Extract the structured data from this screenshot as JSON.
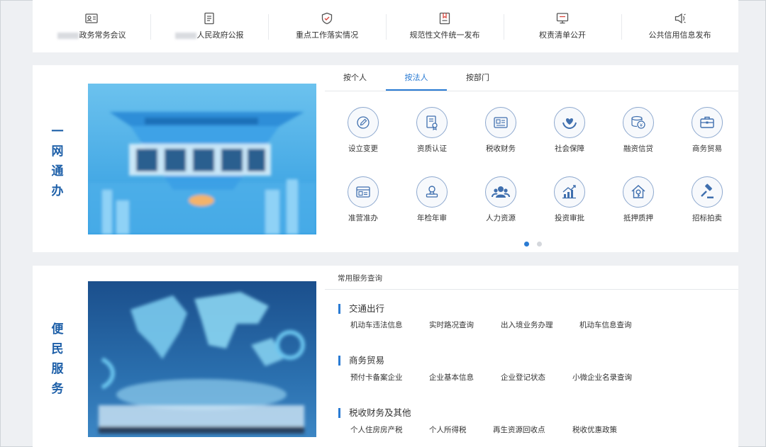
{
  "topnav": [
    {
      "label": "政务常务会议",
      "icon": "id-card-icon"
    },
    {
      "label": "人民政府公报",
      "icon": "document-icon"
    },
    {
      "label": "重点工作落实情况",
      "icon": "shield-check-icon"
    },
    {
      "label": "规范性文件统一发布",
      "icon": "file-bookmark-icon"
    },
    {
      "label": "权责清单公开",
      "icon": "monitor-icon"
    },
    {
      "label": "公共信用信息发布",
      "icon": "megaphone-icon"
    }
  ],
  "yiwang": {
    "title_chars": [
      "一",
      "网",
      "通",
      "办"
    ],
    "tabs": [
      "按个人",
      "按法人",
      "按部门"
    ],
    "active_tab": "按法人",
    "services": [
      {
        "label": "设立变更",
        "icon": "edit-icon"
      },
      {
        "label": "资质认证",
        "icon": "certificate-icon"
      },
      {
        "label": "税收财务",
        "icon": "tax-card-icon"
      },
      {
        "label": "社会保障",
        "icon": "heart-hands-icon"
      },
      {
        "label": "融资信贷",
        "icon": "coins-icon"
      },
      {
        "label": "商务贸易",
        "icon": "briefcase-icon"
      },
      {
        "label": "准营准办",
        "icon": "license-icon"
      },
      {
        "label": "年检年审",
        "icon": "stamp-icon"
      },
      {
        "label": "人力资源",
        "icon": "people-icon"
      },
      {
        "label": "投资审批",
        "icon": "growth-chart-icon"
      },
      {
        "label": "抵押质押",
        "icon": "house-key-icon"
      },
      {
        "label": "招标拍卖",
        "icon": "gavel-icon"
      }
    ],
    "carousel_pages": 2,
    "carousel_active": 1
  },
  "bianmin": {
    "title_chars": [
      "便",
      "民",
      "服",
      "务"
    ],
    "section_title": "常用服务查询",
    "groups": [
      {
        "title": "交通出行",
        "links": [
          "机动车违法信息",
          "实时路况查询",
          "出入境业务办理",
          "机动车信息查询"
        ]
      },
      {
        "title": "商务贸易",
        "links": [
          "预付卡备案企业",
          "企业基本信息",
          "企业登记状态",
          "小微企业名录查询"
        ]
      },
      {
        "title": "税收财务及其他",
        "links": [
          "个人住房房产税",
          "个人所得税",
          "再生资源回收点",
          "税收优惠政策"
        ]
      }
    ]
  },
  "colors": {
    "accent": "#2a7bd3",
    "title_blue": "#1d5fa8",
    "icon_ring": "#8ea9cf"
  }
}
